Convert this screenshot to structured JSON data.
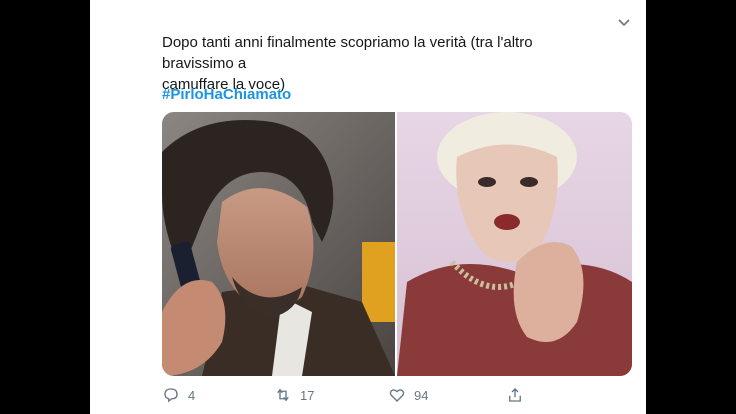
{
  "tweet": {
    "text_line1": "Dopo tanti anni finalmente scopriamo la verità (tra l'altro bravissimo a",
    "text_line2": "camuffare la voce)",
    "hashtag": "#PirloHaChiamato",
    "menu_icon": "chevron-down-icon"
  },
  "media": {
    "left_photo": "man-on-phone-photo",
    "right_photo": "woman-talking-photo"
  },
  "actions": {
    "reply_count": "4",
    "retweet_count": "17",
    "like_count": "94",
    "icons": [
      "reply-icon",
      "retweet-icon",
      "like-icon",
      "share-icon"
    ]
  },
  "colors": {
    "hashtag": "#1b95e0",
    "action_gray": "#657786",
    "text": "#14171a",
    "background": "#000000"
  }
}
